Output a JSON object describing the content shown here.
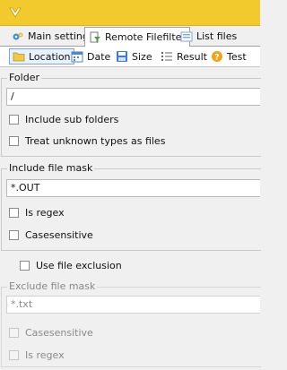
{
  "app": {
    "icon": "app-logo-icon"
  },
  "main_tabs": [
    {
      "label": "Main settings",
      "icon": "settings-icon"
    },
    {
      "label": "Remote Filefilter",
      "icon": "filter-icon"
    },
    {
      "label": "List files",
      "icon": "list-files-icon"
    }
  ],
  "sub_tabs": [
    {
      "label": "Location",
      "icon": "folder-icon"
    },
    {
      "label": "Date",
      "icon": "calendar-icon"
    },
    {
      "label": "Size",
      "icon": "disk-icon"
    },
    {
      "label": "Result",
      "icon": "list-icon"
    },
    {
      "label": "Test",
      "icon": "help-icon"
    }
  ],
  "folder": {
    "legend": "Folder",
    "value": "/",
    "include_sub_folders": "Include sub folders",
    "treat_unknown": "Treat unknown types as files"
  },
  "include_mask": {
    "legend": "Include file mask",
    "value": "*.OUT",
    "is_regex": "Is regex",
    "casesensitive": "Casesensitive"
  },
  "use_exclusion": "Use file exclusion",
  "exclude_mask": {
    "legend": "Exclude file mask",
    "value": "*.txt",
    "casesensitive": "Casesensitive",
    "is_regex": "Is regex"
  },
  "colors": {
    "titlebar": "#f2ca2e",
    "tab_active_border": "#7ea6d9"
  }
}
